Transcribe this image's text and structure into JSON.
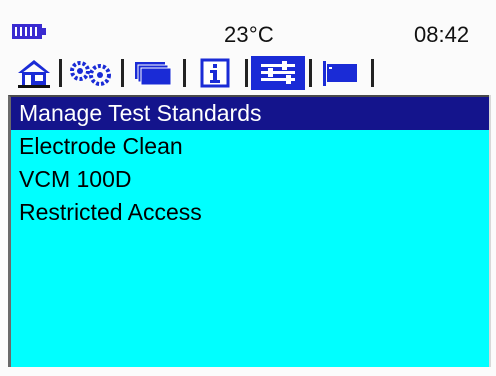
{
  "status_bar": {
    "battery_icon": "battery-full-icon",
    "temperature": "23°C",
    "time": "08:42"
  },
  "tabs": [
    {
      "icon": "home-icon",
      "active": false
    },
    {
      "icon": "gears-icon",
      "active": false
    },
    {
      "icon": "folders-icon",
      "active": false
    },
    {
      "icon": "info-icon",
      "active": false
    },
    {
      "icon": "sliders-icon",
      "active": true
    },
    {
      "icon": "flag-icon",
      "active": false
    }
  ],
  "menu": {
    "items": [
      {
        "label": "Manage Test Standards",
        "selected": true
      },
      {
        "label": "Electrode Clean",
        "selected": false
      },
      {
        "label": "VCM 100D",
        "selected": false
      },
      {
        "label": "Restricted Access",
        "selected": false
      }
    ]
  },
  "colors": {
    "panel_background": "#00ffff",
    "selection_background": "#14148c",
    "active_tab": "#1a2bd6",
    "battery": "#3a2bd0"
  }
}
